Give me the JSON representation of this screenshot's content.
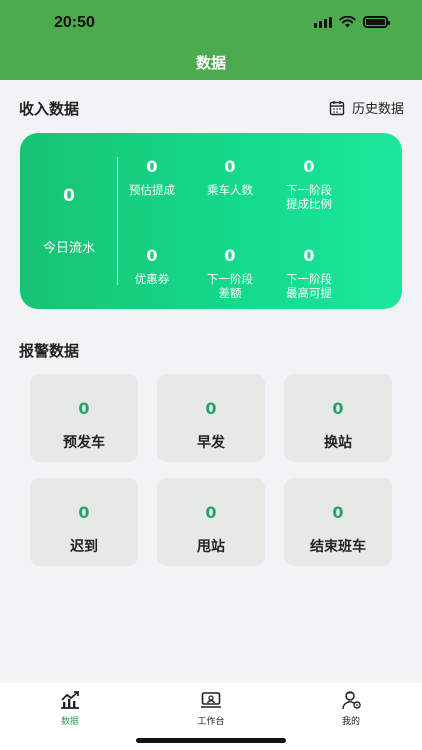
{
  "status_bar": {
    "time": "20:50"
  },
  "header": {
    "title": "数据"
  },
  "income": {
    "title": "收入数据",
    "history_label": "历史数据",
    "today": {
      "value": "0",
      "label": "今日流水"
    },
    "metrics": [
      {
        "value": "0",
        "label": "预估提成"
      },
      {
        "value": "0",
        "label": "乘车人数"
      },
      {
        "value": "0",
        "label": "下一阶段\n提成比例"
      },
      {
        "value": "0",
        "label": "优惠券"
      },
      {
        "value": "0",
        "label": "下一阶段\n差额"
      },
      {
        "value": "0",
        "label": "下一阶段\n最高可提"
      }
    ]
  },
  "alarm": {
    "title": "报警数据",
    "tiles": [
      {
        "value": "0",
        "label": "预发车"
      },
      {
        "value": "0",
        "label": "早发"
      },
      {
        "value": "0",
        "label": "换站"
      },
      {
        "value": "0",
        "label": "迟到"
      },
      {
        "value": "0",
        "label": "甩站"
      },
      {
        "value": "0",
        "label": "结束班车"
      }
    ]
  },
  "tabbar": {
    "items": [
      {
        "label": "数据",
        "icon": "chart-icon",
        "active": true
      },
      {
        "label": "工作台",
        "icon": "monitor-icon",
        "active": false
      },
      {
        "label": "我的",
        "icon": "user-icon",
        "active": false
      }
    ]
  },
  "colors": {
    "brand": "#4caa4f",
    "accent": "#17c372",
    "alarm_value": "#26a36a",
    "active_tab": "#2a9d57"
  }
}
